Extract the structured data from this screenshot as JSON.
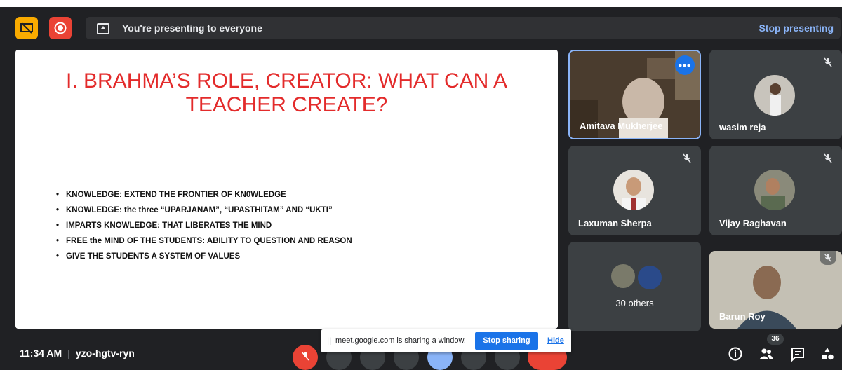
{
  "topbar": {
    "presenting_text": "You're presenting to everyone",
    "stop_presenting_label": "Stop presenting",
    "colors": {
      "screen_off_btn": "#f9ab00",
      "record_btn": "#ea4335",
      "link": "#8ab4f8"
    }
  },
  "slide": {
    "title": "I. BRAHMA’S ROLE, CREATOR: WHAT CAN A TEACHER CREATE?",
    "title_color": "#e32b2b",
    "bullets": [
      "KNOWLEDGE: EXTEND THE FRONTIER OF KN0WLEDGE",
      "KNOWLEDGE: the three “UPARJANAM”, “UPASTHITAM” AND “UKTI”",
      "IMPARTS KNOWLEDGE: THAT LIBERATES THE MIND",
      "FREE the MIND OF THE STUDENTS: ABILITY TO QUESTION AND REASON",
      "GIVE THE STUDENTS A SYSTEM OF VALUES"
    ]
  },
  "participants": [
    {
      "name": "Amitava Mukherjee",
      "active_speaker": true
    },
    {
      "name": "wasim reja",
      "muted": true
    },
    {
      "name": "Laxuman Sherpa",
      "muted": true
    },
    {
      "name": "Vijay Raghavan",
      "muted": true
    },
    {
      "name": "30 others"
    },
    {
      "name": "Barun Roy",
      "muted": true
    }
  ],
  "share_popup": {
    "message": "meet.google.com is sharing a window.",
    "stop_label": "Stop sharing",
    "hide_label": "Hide"
  },
  "bottombar": {
    "time": "11:34 AM",
    "meeting_code": "yzo-hgtv-ryn",
    "people_count": "36",
    "icons": [
      "info-icon",
      "people-icon",
      "chat-icon",
      "activities-icon"
    ]
  }
}
